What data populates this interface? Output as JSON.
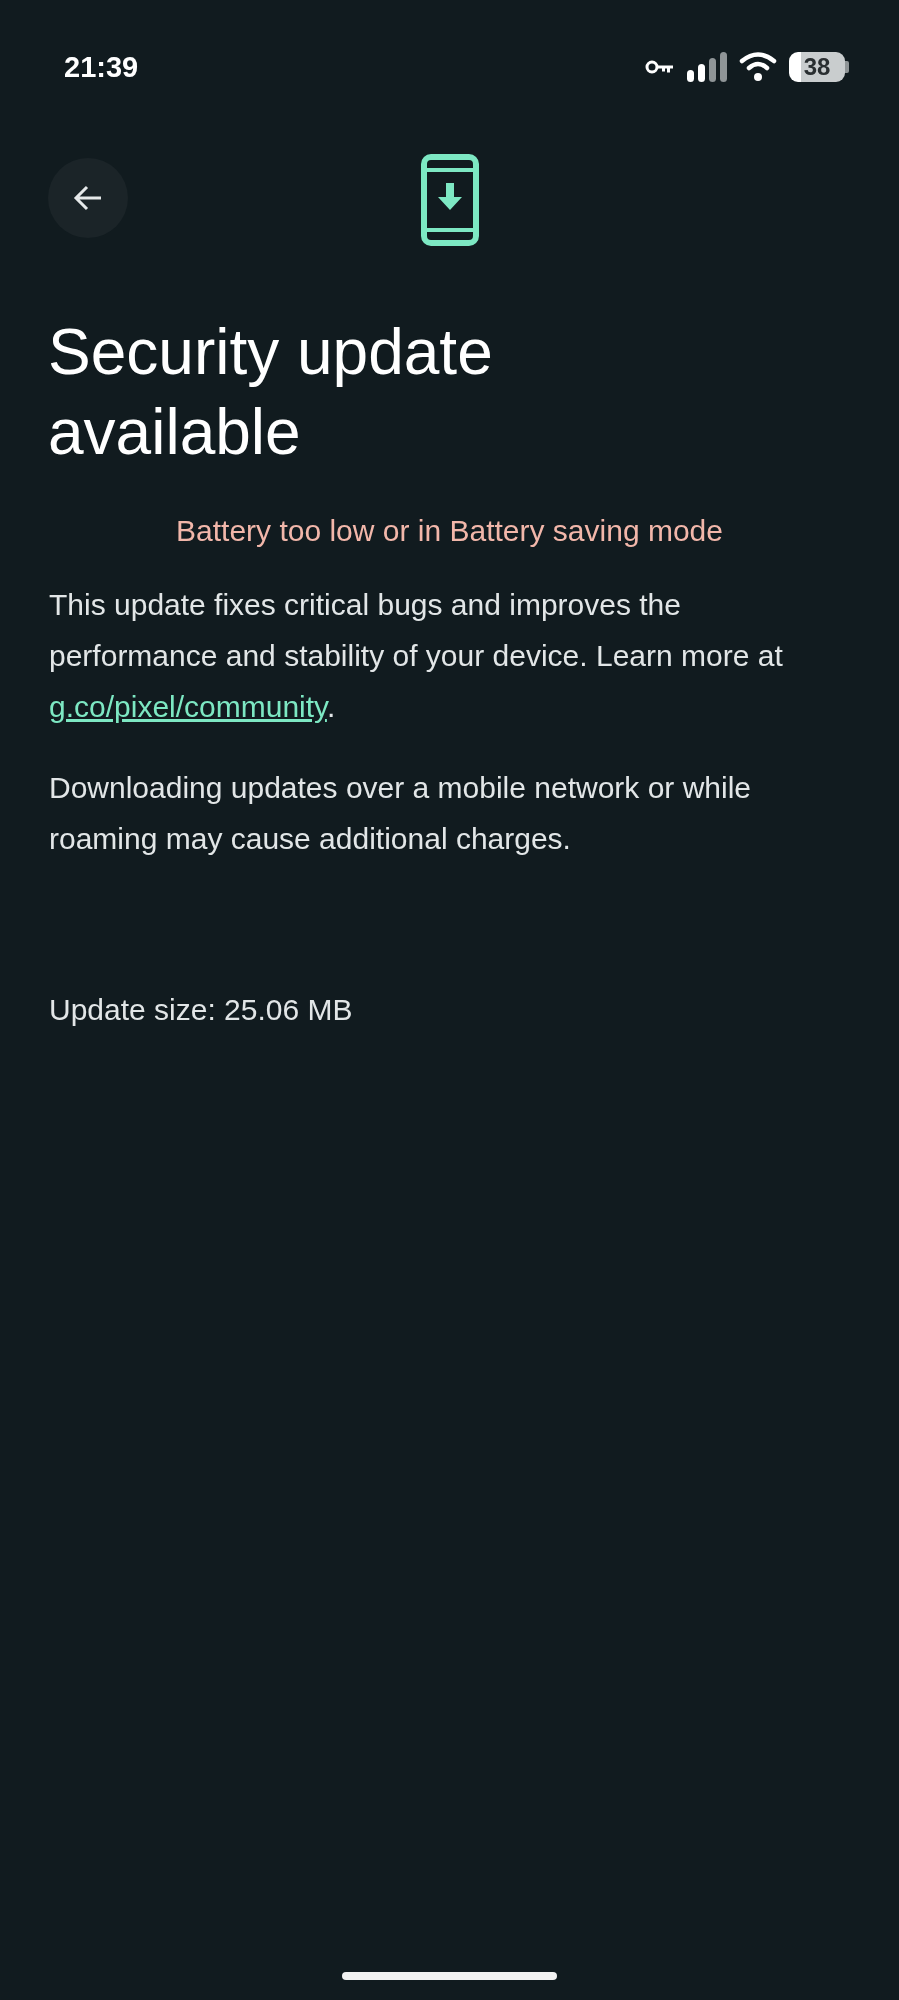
{
  "status_bar": {
    "time": "21:39",
    "battery": "38"
  },
  "title": "Security update available",
  "warning": "Battery too low or in Battery saving mode",
  "description": {
    "before": "This update fixes critical bugs and improves the performance and stability of your device. Learn more at ",
    "link": "g.co/pixel/community",
    "after": "."
  },
  "notice": "Downloading updates over a mobile network or while roaming may cause additional charges.",
  "update_size": "Update size: 25.06 MB"
}
